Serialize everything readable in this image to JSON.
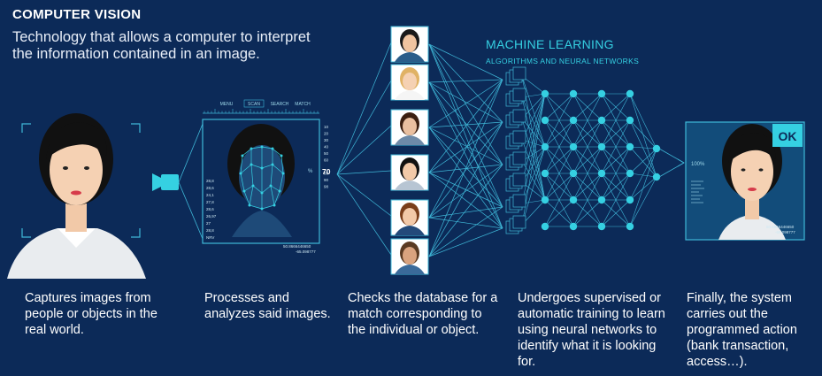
{
  "header": {
    "title": "COMPUTER VISION",
    "subtitle": "Technology that allows a computer to interpret the information contained in an image."
  },
  "machine_learning": {
    "title": "MACHINE LEARNING",
    "subtitle": "ALGORITHMS AND NEURAL NETWORKS"
  },
  "scanner": {
    "menu_items": [
      "MENU",
      "SCAN",
      "SEARCH",
      "MATCH"
    ],
    "left_values": [
      "28,8",
      "28,6",
      "24,1",
      "27,8",
      "28,6",
      "26,97",
      "27",
      "28,8",
      "NRV"
    ],
    "right_values": [
      "10",
      "20",
      "30",
      "40",
      "50",
      "60",
      "70",
      "80",
      "90",
      "98"
    ],
    "percent_label": "%",
    "highlight_value": "70",
    "coords": [
      "50.8666446650",
      "-65.098777"
    ]
  },
  "result": {
    "ok_label": "OK",
    "percent_label": "100%",
    "coords": [
      "50.8666446650",
      "-65.098777"
    ]
  },
  "steps": [
    {
      "caption": "Captures images from people or objects in the real world."
    },
    {
      "caption": "Processes and analyzes said images."
    },
    {
      "caption": "Checks the database for a match corresponding to the individual or object."
    },
    {
      "caption": "Undergoes supervised or automatic training to learn using neural networks to identify what it is looking for."
    },
    {
      "caption": "Finally, the system carries out the programmed action (bank transaction, access…)."
    }
  ],
  "colors": {
    "background": "#0c2a58",
    "accent": "#35d0e2",
    "line": "#3fb8d8"
  }
}
